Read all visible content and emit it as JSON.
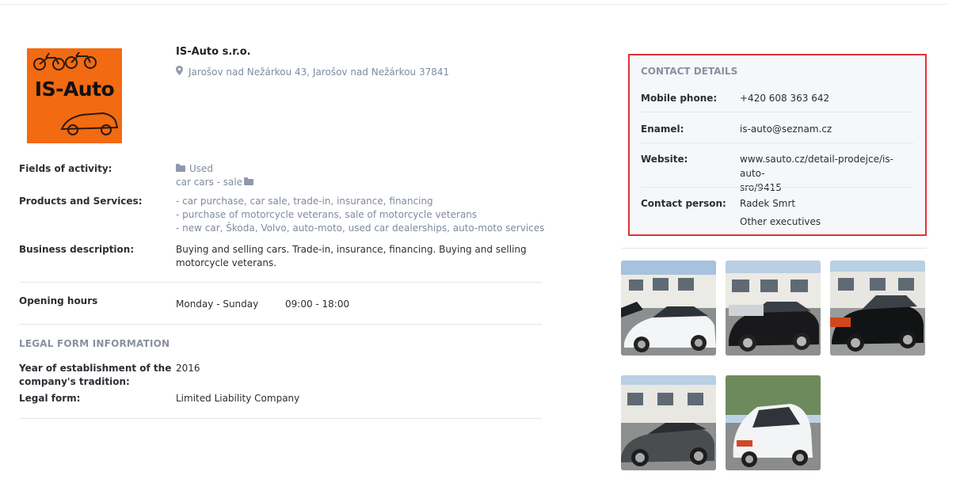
{
  "company": {
    "logo_text": "IS-Auto",
    "name": "IS-Auto s.r.o.",
    "address": "Jarošov nad Nežárkou 43, Jarošov nad Nežárkou 37841"
  },
  "details": {
    "fields_label": "Fields of activity:",
    "fields_value1": "Used",
    "fields_value2": "car cars - sale",
    "products_label": "Products and Services:",
    "products": [
      "- car purchase, car sale, trade-in, insurance, financing",
      "- purchase of motorcycle veterans, sale of motorcycle veterans",
      "- new car, Škoda, Volvo, auto-moto, used car dealerships, auto-moto services"
    ],
    "business_label": "Business description:",
    "business_line1": "Buying and selling cars. Trade-in, insurance, financing. Buying and selling",
    "business_line2": "motorcycle veterans.",
    "hours_label": "Opening hours",
    "hours_days": "Monday - Sunday",
    "hours_time": "09:00 - 18:00"
  },
  "legal": {
    "title": "LEGAL FORM INFORMATION",
    "year_label_1": "Year of establishment of the",
    "year_label_2": "company's tradition:",
    "year_value": "2016",
    "form_label": "Legal form:",
    "form_value": "Limited Liability Company"
  },
  "contact": {
    "title": "CONTACT DETAILS",
    "phone_label": "Mobile phone:",
    "phone_value": "+420 608 363 642",
    "email_label": "Enamel:",
    "email_value": "is-auto@seznam.cz",
    "website_label": "Website:",
    "website_line1": "www.sauto.cz/detail-prodejce/is-auto-",
    "website_line2": "sro/9415",
    "person_label": "Contact person:",
    "person_value": "Radek Smrt",
    "other_execs": "Other executives"
  },
  "colors": {
    "accent_red": "#e0313b",
    "logo_orange": "#f26a12",
    "muted": "#7f8aa0"
  }
}
